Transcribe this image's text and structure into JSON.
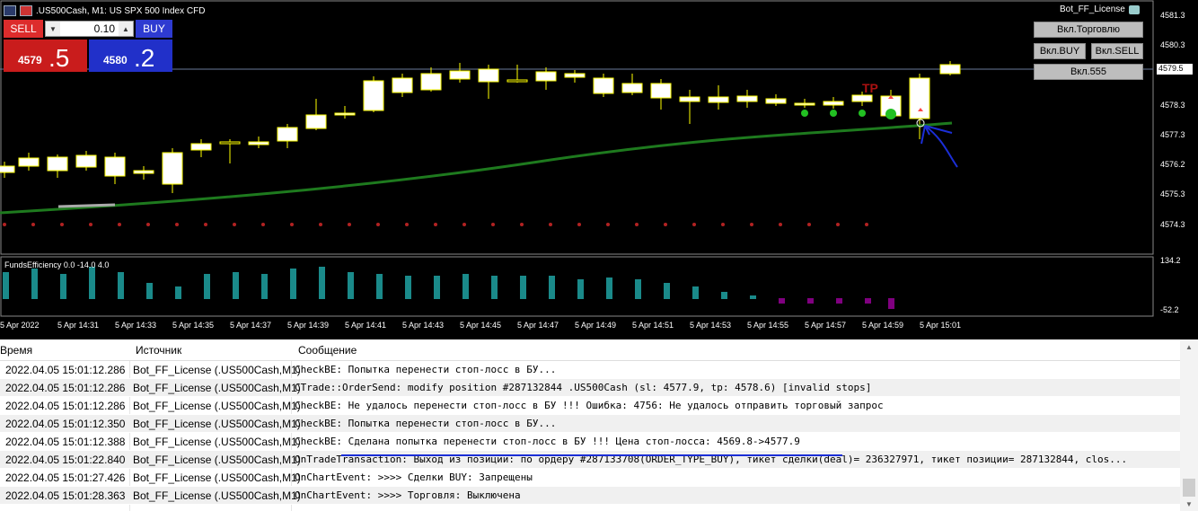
{
  "chart": {
    "symbol_title": ".US500Cash, M1:  US SPX 500 Index CFD",
    "bot_name": "Bot_FF_License",
    "lot_value": "0.10",
    "sell_label": "SELL",
    "buy_label": "BUY",
    "sell_price_small": "4579",
    "sell_price_big": ".5",
    "buy_price_small": "4580",
    "buy_price_big": ".2",
    "btn_trading": "Вкл.Торговлю",
    "btn_buy": "Вкл.BUY",
    "btn_sell": "Вкл.SELL",
    "btn_555": "Вкл.555",
    "tp_label": "TP",
    "current_price": "4579.5",
    "subwindow_label": "FundsEfficiency 0.0 -14.0 4.0",
    "price_ticks": [
      "4581.3",
      "4580.3",
      "4579.5",
      "4578.3",
      "4577.3",
      "4576.2",
      "4575.3",
      "4574.3"
    ],
    "sub_ticks": [
      "134.2",
      "-52.2"
    ],
    "time_ticks": [
      "5 Apr 2022",
      "5 Apr 14:31",
      "5 Apr 14:33",
      "5 Apr 14:35",
      "5 Apr 14:37",
      "5 Apr 14:39",
      "5 Apr 14:41",
      "5 Apr 14:43",
      "5 Apr 14:45",
      "5 Apr 14:47",
      "5 Apr 14:49",
      "5 Apr 14:51",
      "5 Apr 14:53",
      "5 Apr 14:55",
      "5 Apr 14:57",
      "5 Apr 14:59",
      "5 Apr 15:01"
    ],
    "colors": {
      "bg": "#000000",
      "candle": "#ffff00",
      "ma": "#1e7a1e",
      "dots": "#b22222",
      "hist_pos": "#1a8a8a",
      "hist_neg": "#800080"
    }
  },
  "journal": {
    "headers": {
      "time": "Время",
      "source": "Источник",
      "message": "Сообщение"
    },
    "rows": [
      {
        "time": "2022.04.05 15:01:12.286",
        "source": "Bot_FF_License (.US500Cash,M1)",
        "message": "CheckBE: Попытка перенести стоп-лосс в БУ..."
      },
      {
        "time": "2022.04.05 15:01:12.286",
        "source": "Bot_FF_License (.US500Cash,M1)",
        "message": "CTrade::OrderSend: modify position #287132844 .US500Cash (sl: 4577.9, tp: 4578.6) [invalid stops]"
      },
      {
        "time": "2022.04.05 15:01:12.286",
        "source": "Bot_FF_License (.US500Cash,M1)",
        "message": "CheckBE: Не удалось перенести стоп-лосс в БУ !!! Ошибка: 4756: Не удалось отправить торговый запрос"
      },
      {
        "time": "2022.04.05 15:01:12.350",
        "source": "Bot_FF_License (.US500Cash,M1)",
        "message": "CheckBE: Попытка перенести стоп-лосс в БУ..."
      },
      {
        "time": "2022.04.05 15:01:12.388",
        "source": "Bot_FF_License (.US500Cash,M1)",
        "message": "CheckBE: Сделана попытка перенести стоп-лосс в БУ !!! Цена стоп-лосса: 4569.8->4577.9"
      },
      {
        "time": "2022.04.05 15:01:22.840",
        "source": "Bot_FF_License (.US500Cash,M1)",
        "message": "OnTradeTransaction: Выход из позиции: по ордеру #287133708(ORDER_TYPE_BUY), тикет сделки(deal)= 236327971, тикет позиции= 287132844, clos..."
      },
      {
        "time": "2022.04.05 15:01:27.426",
        "source": "Bot_FF_License (.US500Cash,M1)",
        "message": "OnChartEvent: >>>> Сделки BUY: Запрещены"
      },
      {
        "time": "2022.04.05 15:01:28.363",
        "source": "Bot_FF_License (.US500Cash,M1)",
        "message": "OnChartEvent: >>>> Торговля: Выключена"
      }
    ]
  }
}
